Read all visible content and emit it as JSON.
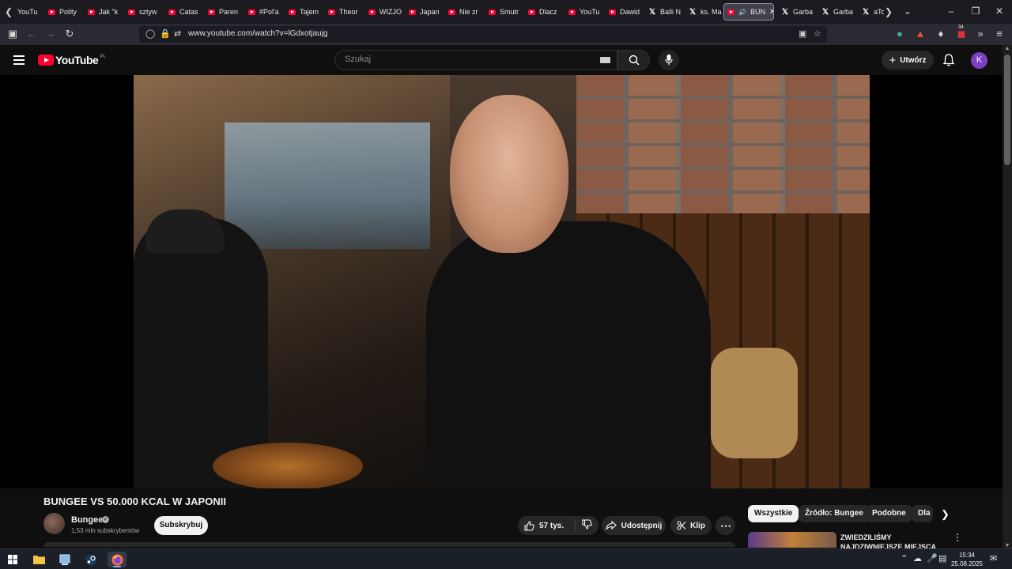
{
  "browser": {
    "tabs": [
      {
        "label": "YouTu",
        "icon": "youtube"
      },
      {
        "label": "Polity",
        "icon": "youtube"
      },
      {
        "label": "Jak \"k",
        "icon": "youtube"
      },
      {
        "label": "sztyw",
        "icon": "youtube"
      },
      {
        "label": "Catas",
        "icon": "youtube"
      },
      {
        "label": "Paren",
        "icon": "youtube"
      },
      {
        "label": "#Pol'a",
        "icon": "youtube"
      },
      {
        "label": "Tajem",
        "icon": "youtube"
      },
      {
        "label": "Theor",
        "icon": "youtube"
      },
      {
        "label": "WIZJO",
        "icon": "youtube"
      },
      {
        "label": "Japan",
        "icon": "youtube"
      },
      {
        "label": "Nie zr",
        "icon": "youtube"
      },
      {
        "label": "Smutr",
        "icon": "youtube"
      },
      {
        "label": "Dlacz",
        "icon": "youtube"
      },
      {
        "label": "YouTu",
        "icon": "youtube"
      },
      {
        "label": "Dawid",
        "icon": "youtube"
      },
      {
        "label": "Balli N",
        "icon": "x"
      },
      {
        "label": "ks. Ma",
        "icon": "x"
      },
      {
        "label": "BUN",
        "icon": "youtube",
        "active": true
      },
      {
        "label": "Garba",
        "icon": "x"
      },
      {
        "label": "Garba",
        "icon": "x"
      },
      {
        "label": "aTo",
        "icon": "x"
      }
    ],
    "url": "www.youtube.com/watch?v=lGdxotjaujg",
    "extension_badge": "34"
  },
  "youtube": {
    "logo_text": "YouTube",
    "country_code": "PL",
    "search_placeholder": "Szukaj",
    "create_label": "Utwórz",
    "avatar_letter": "K"
  },
  "video": {
    "title": "BUNGEE VS 50.000 KCAL W JAPONII",
    "channel_name": "Bungee",
    "subscribers": "1,53 mln subskrybentów",
    "subscribe_label": "Subskrybuj",
    "likes": "57 tys.",
    "share_label": "Udostępnij",
    "clip_label": "Klip"
  },
  "sidebar": {
    "chips": [
      "Wszystkie",
      "Źródło: Bungee",
      "Podobne",
      "Dla"
    ],
    "recommendation_title": "ZWIEDZILIŚMY NAJDZIWNIEJSZE MIEJSCA"
  },
  "taskbar": {
    "time": "15:34",
    "date": "25.08.2025"
  },
  "colors": {
    "youtube_red": "#ff0033",
    "avatar_purple": "#7b3fc5",
    "background": "#0f0f0f"
  }
}
